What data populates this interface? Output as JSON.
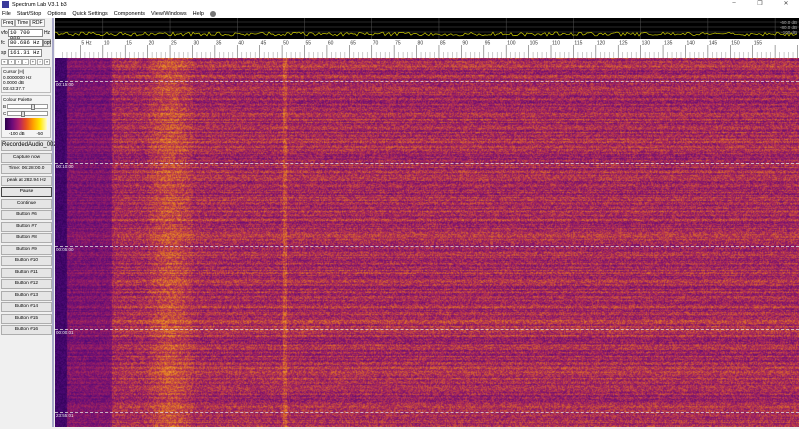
{
  "window": {
    "title": "Spectrum Lab V3.1 b3",
    "minimize": "–",
    "maximize": "❐",
    "close": "✕"
  },
  "menu": [
    "File",
    "Start/Stop",
    "Options",
    "Quick Settings",
    "Components",
    "View/Windows",
    "Help"
  ],
  "left": {
    "tabs": [
      "Freq",
      "Time",
      "RDF"
    ],
    "vfo": {
      "label": "vfo",
      "value": "10 700 000",
      "unit": "Hz"
    },
    "fc": {
      "label": "fc",
      "value": "80.686 Hz",
      "button": "opt"
    },
    "sp": {
      "label": "sp",
      "value": "161.31 Hz"
    },
    "arrows": [
      "«",
      "‹",
      "‹",
      "-",
      "+",
      "›",
      "»"
    ],
    "cursor": {
      "title": "Cursor [H]",
      "freq": "0.0000000 Hz",
      "level": "0.0000 dB",
      "time": "03:43:37.7"
    },
    "palette": {
      "title": "Colour Palette",
      "b_label": "B",
      "c_label": "C",
      "min": "-100 dB",
      "max": "-50",
      "brightness": 0.7,
      "contrast": 0.4
    },
    "buttons": [
      "RecordedAudio_002",
      "Capture now",
      "Time:  06:28:00.0",
      "peak at 282.94 Hz",
      "Pause",
      "Continue",
      "Button #6",
      "Button #7",
      "Button #8",
      "Button #9",
      "Button #10",
      "Button #11",
      "Button #12",
      "Button #13",
      "Button #14",
      "Button #15",
      "Button #16"
    ]
  },
  "spectrum": {
    "db_labels": [
      "-60.0 dB",
      "-80.0 dB",
      "-100 dB"
    ],
    "trace_color": "#c8c800"
  },
  "scale": {
    "unit": "Hz",
    "labels": [
      5,
      10,
      15,
      20,
      25,
      30,
      35,
      40,
      45,
      50,
      55,
      60,
      65,
      70,
      75,
      80,
      85,
      90,
      95,
      100,
      105,
      110,
      115,
      120,
      125,
      130,
      135,
      140,
      145,
      150,
      155
    ],
    "range_hz": [
      0,
      166
    ]
  },
  "waterfall": {
    "timestamps": [
      "00:15:00",
      "00:10:00",
      "00:05:00",
      "00:00:01",
      "23:55:01"
    ]
  }
}
